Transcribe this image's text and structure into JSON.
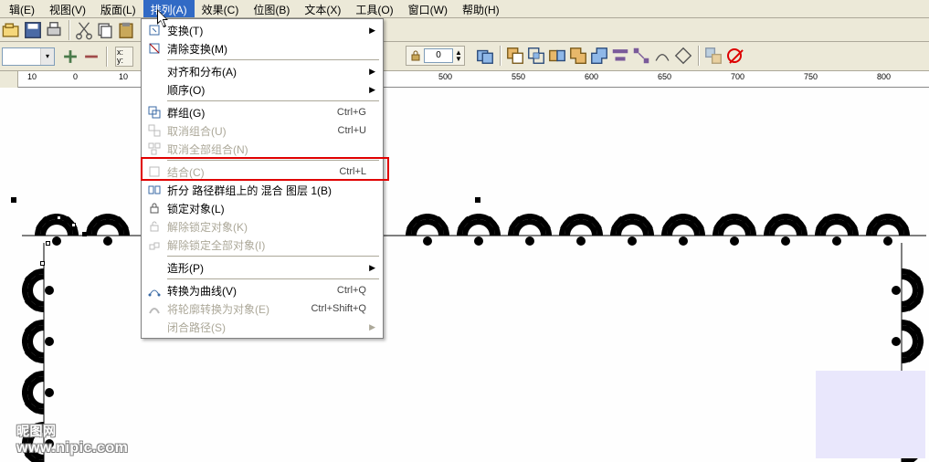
{
  "menubar": {
    "items": [
      {
        "label": "辑(E)",
        "key": "edit"
      },
      {
        "label": "视图(V)",
        "key": "view"
      },
      {
        "label": "版面(L)",
        "key": "layout"
      },
      {
        "label": "排列(A)",
        "key": "arrange",
        "active": true
      },
      {
        "label": "效果(C)",
        "key": "effects"
      },
      {
        "label": "位图(B)",
        "key": "bitmap"
      },
      {
        "label": "文本(X)",
        "key": "text"
      },
      {
        "label": "工具(O)",
        "key": "tools"
      },
      {
        "label": "窗口(W)",
        "key": "window"
      },
      {
        "label": "帮助(H)",
        "key": "help"
      }
    ]
  },
  "dropdown": {
    "items": [
      {
        "label": "变换(T)",
        "submenu": true,
        "icon": "transform"
      },
      {
        "label": "清除变换(M)",
        "icon": "clear-transform"
      },
      {
        "sep": true
      },
      {
        "label": "对齐和分布(A)",
        "submenu": true
      },
      {
        "label": "顺序(O)",
        "submenu": true
      },
      {
        "sep": true
      },
      {
        "label": "群组(G)",
        "shortcut": "Ctrl+G",
        "icon": "group"
      },
      {
        "label": "取消组合(U)",
        "shortcut": "Ctrl+U",
        "icon": "ungroup",
        "disabled": true
      },
      {
        "label": "取消全部组合(N)",
        "icon": "ungroup-all",
        "disabled": true
      },
      {
        "sep": true
      },
      {
        "label": "结合(C)",
        "shortcut": "Ctrl+L",
        "icon": "combine",
        "disabled": true
      },
      {
        "label": "折分 路径群组上的 混合 图层 1(B)",
        "icon": "break",
        "highlight": true
      },
      {
        "label": "锁定对象(L)",
        "icon": "lock"
      },
      {
        "label": "解除锁定对象(K)",
        "icon": "unlock",
        "disabled": true
      },
      {
        "label": "解除锁定全部对象(I)",
        "icon": "unlock-all",
        "disabled": true
      },
      {
        "sep": true
      },
      {
        "label": "造形(P)",
        "submenu": true
      },
      {
        "sep": true
      },
      {
        "label": "转换为曲线(V)",
        "shortcut": "Ctrl+Q",
        "icon": "to-curve"
      },
      {
        "label": "将轮廓转换为对象(E)",
        "shortcut": "Ctrl+Shift+Q",
        "icon": "outline-to-obj",
        "disabled": true
      },
      {
        "label": "闭合路径(S)",
        "submenu": true,
        "disabled": true
      }
    ]
  },
  "toolbar2": {
    "xy_label": "x:\ny:",
    "spinner_value": "0"
  },
  "ruler": {
    "ticks": [
      "10",
      "0",
      "10",
      "500",
      "550",
      "600",
      "650",
      "700",
      "750",
      "800"
    ]
  },
  "watermark": {
    "line1": "昵图网",
    "line2": "www.nipic.com"
  }
}
